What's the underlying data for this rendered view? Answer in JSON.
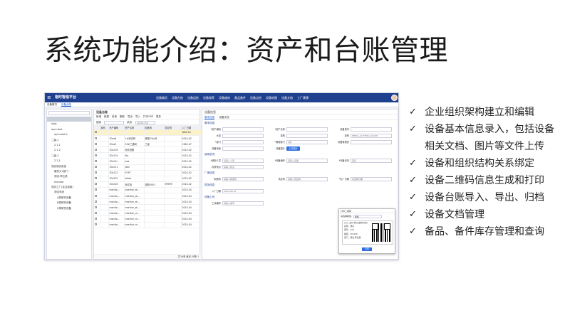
{
  "slide": {
    "title": "系统功能介绍：资产和台账管理"
  },
  "app": {
    "logo": "格时智造平台",
    "nav": [
      "设备概况",
      "设备台账",
      "设备运检",
      "设备保养",
      "设备维修",
      "备品备件",
      "设备点检",
      "设备地图",
      "设备文档",
      "工厂建模"
    ],
    "tabs": [
      "设备概况",
      "设备台账"
    ],
    "tree": {
      "search_placeholder": "",
      "nodes": [
        "",
        "hqkj",
        "aym.test",
        "aym.test-1",
        "二级-1",
        "2.1.1",
        "2.1.2",
        "二级-2",
        "2.2.1",
        "测试测试系统",
        "服务头1部门",
        "测试-李仕其",
        "monitor",
        "测试工厂(实当用用)",
        "测试车间",
        "A类研究设备",
        "B类研究设备",
        "C类研究设备"
      ]
    },
    "grid": {
      "title": "设备台账",
      "toolbar": [
        "新增",
        "新建",
        "查询",
        "删除",
        "导出",
        "导入",
        "打印CRP",
        "更多"
      ],
      "filter_label": "搜索",
      "filter_status_label": "状态:",
      "filter_status_value": "请选择:状态",
      "columns": [
        "",
        "操作",
        "资产编码",
        "资产名称",
        "制造商",
        "供应商",
        "入厂日期"
      ],
      "rows": [
        [
          "",
          "",
          "",
          "",
          "",
          "",
          "Wed Au"
        ],
        [
          "",
          "",
          "30ca6",
          "1#测试阀",
          "美国23公司",
          "",
          "2024-02"
        ],
        [
          "",
          "",
          "30ca5",
          "25#三通阀",
          "三星",
          "",
          "1982-07"
        ],
        [
          "",
          "",
          "30c216",
          "测试设备",
          "",
          "",
          "2024-02"
        ],
        [
          "",
          "",
          "30c219",
          "Ilts",
          "",
          "",
          "2024-02"
        ],
        [
          "",
          "",
          "30c21c",
          "aaa",
          "",
          "",
          "2024-02"
        ],
        [
          "",
          "",
          "30c211",
          "ddd",
          "",
          "",
          "2024-02"
        ],
        [
          "",
          "",
          "30c222",
          "FOFF",
          "",
          "",
          "2024-02"
        ],
        [
          "",
          "",
          "30c225",
          "eblea",
          "",
          "",
          "2024-02"
        ],
        [
          "",
          "",
          "30c226",
          "测试设",
          "锐新5001",
          "99999",
          "2024-02"
        ],
        [
          "",
          "",
          "monito...",
          "monitor_at...",
          "",
          "",
          "2024-04"
        ],
        [
          "",
          "",
          "monito...",
          "monitor_at...",
          "",
          "",
          "2024-04"
        ],
        [
          "",
          "",
          "monito...",
          "monitor_at...",
          "",
          "",
          "2024-04"
        ],
        [
          "",
          "",
          "monito...",
          "monitor_at...",
          "",
          "",
          "2024-04"
        ],
        [
          "",
          "",
          "monito...",
          "monitor_m...",
          "",
          "",
          "2024-04"
        ],
        [
          "",
          "",
          "monito...",
          "monitor_m...",
          "",
          "",
          "2024-04"
        ],
        [
          "",
          "",
          "monito...",
          "monitor_m...",
          "",
          "",
          "2024-04"
        ]
      ],
      "footer": "共19条 每页 50条 1"
    },
    "form": {
      "title": "设备信息",
      "tabs": [
        "基本信息",
        "设备文档"
      ],
      "sections": {
        "basic": "基本信息",
        "usage": "使用状况",
        "factory": "厂家信息",
        "finance": "财务信息",
        "upload": "设备上传"
      },
      "fields": {
        "asset_code": "*资产编码",
        "asset_name": "*资产名称",
        "model": "设备型号",
        "category_major": "大类",
        "category": "类别",
        "category_value": "METAL_CUTTING_MACHI",
        "category_minor": "*部门",
        "manager_dept": "*管理部门",
        "manager_dept_value": "A类",
        "equip_manager": "设备管理员",
        "purpose": "设备用途",
        "picture": "设备图片",
        "upload_btn": "上传图片",
        "location": "*使用人员",
        "location_value": "请输入人员",
        "equip_no": "*设备编号",
        "equip_no_value": "请输入设备",
        "status": "*设备状态",
        "status_value": "完好",
        "storage": "存放地点",
        "storage_value": "请输入地点",
        "maker": "制造商",
        "maker_value": "请输入制造商",
        "supplier": "供应商",
        "supplier_value": "请输入供应商",
        "enter_date": "*出厂日期",
        "enter_date_value": "请选择日期",
        "purchase_date": "入厂日期",
        "purchase_date_value": "2024-06-21",
        "workshop": "工序编号",
        "workshop_value": "请输入编号"
      }
    },
    "qr_dialog": {
      "title": "打印二维码",
      "select_label": "请选择模板:",
      "select_value": "模板",
      "lines": [
        "名称：测试",
        "型号：123",
        "编码：30c226",
        "部门：测试-李仕其",
        "厂家：锐新5001"
      ],
      "header_line": "公司 二维码 格时设备管理系统",
      "print_btn": "打印"
    }
  },
  "bullets": [
    "企业组织架构建立和编辑",
    "设备基本信息录入，包括设备相关文档、图片等文件上传",
    "设备和组织结构关系绑定",
    "设备二维码信息生成和打印",
    "设备台账导入、导出、归档",
    "设备文档管理",
    "备品、备件库存管理和查询"
  ],
  "icons": {
    "check": "check-icon",
    "menu": "menu-icon"
  }
}
